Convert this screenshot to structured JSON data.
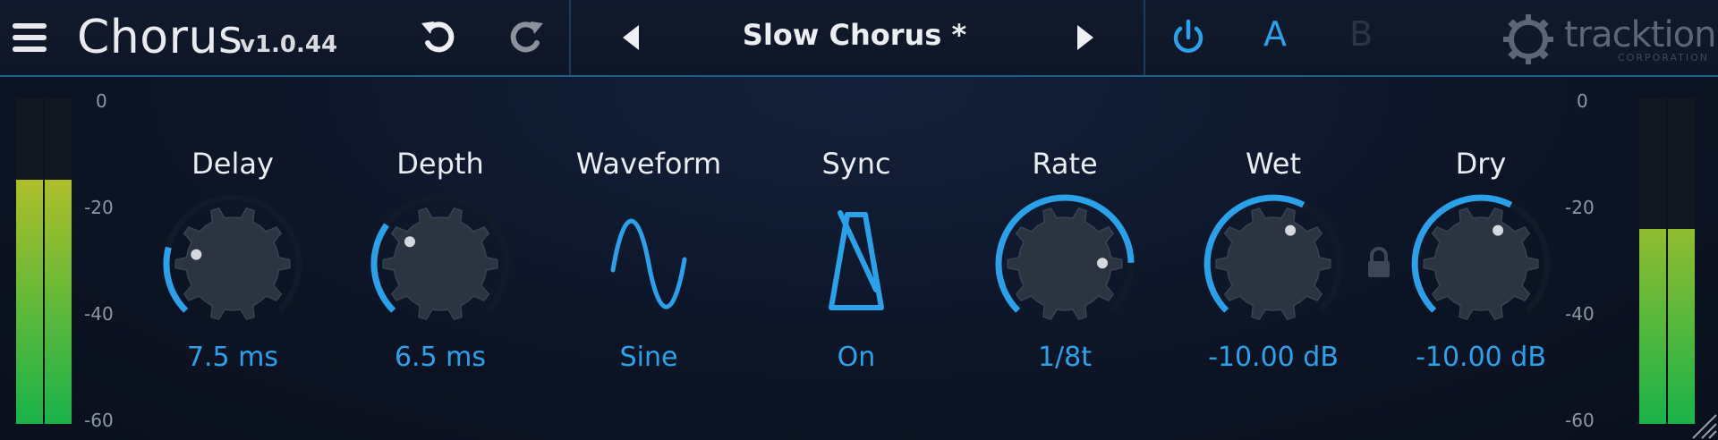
{
  "header": {
    "title": "Chorus",
    "version": "v1.0.44",
    "preset_name": "Slow Chorus *",
    "ab_a": "A",
    "ab_b": "B",
    "logo_text": "tracktion",
    "logo_sub": "CORPORATION"
  },
  "icons": {
    "menu": "hamburger-icon",
    "undo": "undo-icon",
    "redo": "redo-icon",
    "prev": "triangle-left-icon",
    "next": "triangle-right-icon",
    "power": "power-icon",
    "lock": "lock-icon",
    "logo": "gear-logo-icon"
  },
  "colors": {
    "accent": "#2aa2ea",
    "knob": "#2c3442",
    "meter_top": "#e0c21e",
    "meter_bottom": "#19b34a"
  },
  "meters": {
    "scale": [
      "0",
      "-20",
      "-40",
      "-60"
    ],
    "left_level": 0.75,
    "right_level": 0.6
  },
  "controls": [
    {
      "label": "Delay",
      "value": "7.5 ms",
      "type": "knob",
      "level": 0.22
    },
    {
      "label": "Depth",
      "value": "6.5 ms",
      "type": "knob",
      "level": 0.3
    },
    {
      "label": "Waveform",
      "value": "Sine",
      "type": "sine"
    },
    {
      "label": "Sync",
      "value": "On",
      "type": "metronome"
    },
    {
      "label": "Rate",
      "value": "1/8t",
      "type": "knob",
      "level": 0.83
    },
    {
      "label": "Wet",
      "value": "-10.00 dB",
      "type": "knob",
      "level": 0.6
    },
    {
      "label": "Dry",
      "value": "-10.00 dB",
      "type": "knob",
      "level": 0.6
    }
  ]
}
